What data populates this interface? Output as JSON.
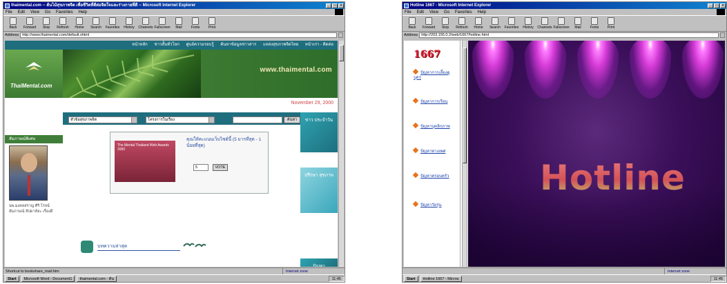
{
  "left_window": {
    "title": "thaimental.com -- ต้นไม้สุขภาพจิต เพื่อชีวิตที่ดีต่อจิตใจและร่างกายที่ดี -- Microsoft Internet Explorer",
    "menu": [
      "File",
      "Edit",
      "View",
      "Go",
      "Favorites",
      "Help"
    ],
    "toolbar": [
      "Back",
      "Forward",
      "Stop",
      "Refresh",
      "Home",
      "Search",
      "Favorites",
      "History",
      "Channels",
      "Fullscreen",
      "Mail",
      "Fonts",
      "Print"
    ],
    "address_label": "Address",
    "address_value": "http://www.thaimental.com/default.shtml",
    "site": {
      "nav": [
        "หน้าหลัก",
        "ข่าวสั้นทั่วโลก",
        "ศูนย์ความรอบรู้",
        "ค้นหาข้อมูลข่าวสาร",
        "แหล่งสุขภาพจิตไทย",
        "หน้าเก่า - ติดต่อ"
      ],
      "logo_text": "ThaiMental.com",
      "www_text": "www.thaimental.com",
      "date": "November 29, 2000",
      "select1": "หัวข้อสุขภาพจิต",
      "select2": "โครงการในเรื่อง",
      "search_btn": "ค้นหา",
      "side_heading": "สัมภาษณ์พิเศษ",
      "caption": "นพ.มงคลสราญ ศิริ โรจน์ สัมภาษณ์ สัปดาห์ละ เรื่องดี",
      "promo_img_text": "The Mental Thailand Web Awards 2000",
      "promo_text": "คุณให้คะแนนเว็บไซต์นี้ (5 มากที่สุด - 1 น้อยที่สุด)",
      "promo_select": "5",
      "promo_btn": "VOTE",
      "banner1": "ข่าว ประจำวัน",
      "banner2": "ปรึกษา สุขภาพ",
      "banner3": "ปัญหา",
      "bottom_item": "บทความล่าสุด"
    },
    "status": "Shortcut to bookshare_mail.htm",
    "zone": "Internet zone",
    "taskbar": [
      "Start",
      "Microsoft Word - Document1",
      "thaimental.com - ต้น"
    ],
    "tray": "11:45"
  },
  "right_window": {
    "title": "Hotline 1667 - Microsoft Internet Explorer",
    "menu": [
      "File",
      "Edit",
      "View",
      "Go",
      "Favorites",
      "Help"
    ],
    "toolbar": [
      "Back",
      "Forward",
      "Stop",
      "Refresh",
      "Home",
      "Search",
      "Favorites",
      "History",
      "Channels",
      "Fullscreen",
      "Mail",
      "Fonts",
      "Print"
    ],
    "address_label": "Address",
    "address_value": "http://203.155.0.2/web/1667/hotline.html",
    "site": {
      "heading": "1667",
      "items": [
        "ปัญหาการเลี้ยงดูบุตร",
        "ปัญหาการเรียน",
        "ปัญหาบุคลิกภาพ",
        "ปัญหาทางเพศ",
        "ปัญหาครอบครัว",
        "ปัญหาวัยรุ่น"
      ],
      "banner": "Hotline"
    },
    "status": "",
    "zone": "Internet zone",
    "taskbar": [
      "Start",
      "Hotline 1667 - Micros"
    ],
    "tray": "11:45"
  }
}
